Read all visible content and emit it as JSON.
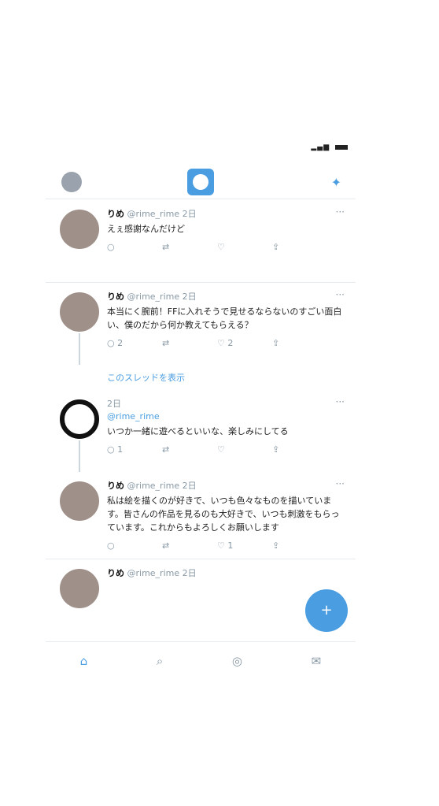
{
  "status": {
    "icons": "signal wifi battery"
  },
  "header": {
    "left": "profile-avatar",
    "center": "home-logo",
    "right": "sparkle-icon"
  },
  "tweets": [
    {
      "name": "りめ",
      "handle": "@rime_rime",
      "time": "2日",
      "text": "えぇ感謝なんだけど",
      "actions": {
        "reply": "",
        "retweet": "",
        "like": "",
        "share": ""
      }
    },
    {
      "name": "りめ",
      "handle": "@rime_rime",
      "time": "2日",
      "text": "本当にく腕前！FFに入れそうで見せるならないのすごい面白い、僕のだから何か教えてもらえる？",
      "actions": {
        "reply": "2",
        "retweet": "",
        "like": "2",
        "share": ""
      }
    },
    {
      "name": "",
      "handle": "",
      "time": "2日",
      "reply_to": "@rime_rime",
      "text": "いつか一緒に遊べるといいな、楽しみにしてる",
      "actions": {
        "reply": "1",
        "retweet": "",
        "like": "",
        "share": ""
      }
    },
    {
      "name": "りめ",
      "handle": "@rime_rime",
      "time": "2日",
      "text": "私は絵を描くのが好きで、いつも色々なものを描いています。皆さんの作品を見るのも大好きで、いつも刺激をもらっています。これからもよろしくお願いします",
      "actions": {
        "reply": "",
        "retweet": "",
        "like": "1",
        "share": ""
      }
    },
    {
      "name": "りめ",
      "handle": "@rime_rime",
      "time": "2日"
    }
  ],
  "show_thread": "このスレッドを表示",
  "tabbar": {
    "home": "⌂",
    "search": "⌕",
    "notifications": "◎",
    "messages": "✉"
  },
  "fab": "+"
}
